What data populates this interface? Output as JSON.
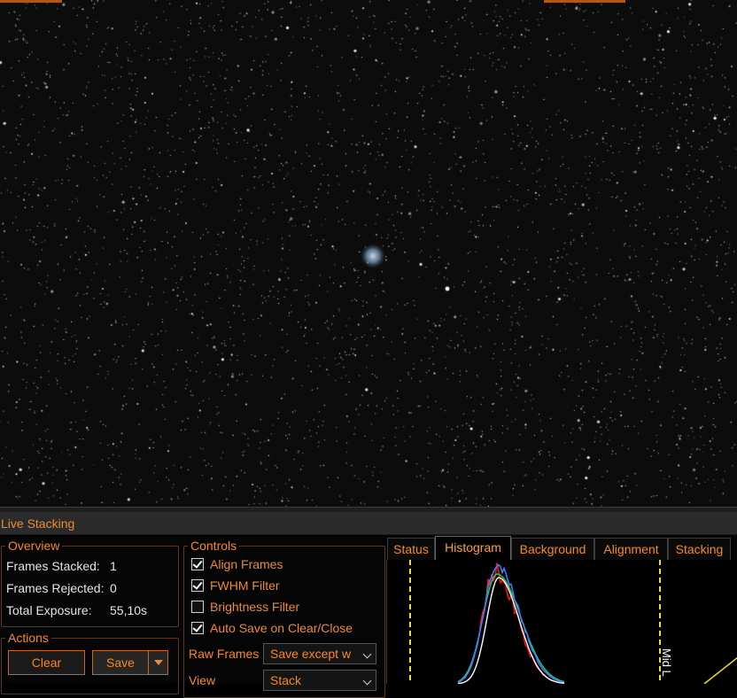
{
  "panel": {
    "title": "Live Stacking"
  },
  "overview": {
    "legend": "Overview",
    "frames_stacked_label": "Frames Stacked:",
    "frames_stacked_value": "1",
    "frames_rejected_label": "Frames Rejected:",
    "frames_rejected_value": "0",
    "total_exposure_label": "Total Exposure:",
    "total_exposure_value": "55,10s"
  },
  "actions": {
    "legend": "Actions",
    "clear_label": "Clear",
    "save_label": "Save"
  },
  "controls": {
    "legend": "Controls",
    "checkboxes": [
      {
        "label": "Align Frames",
        "checked": true
      },
      {
        "label": "FWHM Filter",
        "checked": true
      },
      {
        "label": "Brightness Filter",
        "checked": false
      },
      {
        "label": "Auto Save on Clear/Close",
        "checked": true
      }
    ],
    "raw_frames_label": "Raw Frames",
    "raw_frames_value": "Save except w",
    "view_label": "View",
    "view_value": "Stack"
  },
  "tabs": [
    "Status",
    "Histogram",
    "Background",
    "Alignment",
    "Stacking"
  ],
  "active_tab": "Histogram",
  "histogram": {
    "marker_label": "Mid L"
  },
  "colors": {
    "accent": "#f08a2a",
    "background": "#000000",
    "red": "#ff1010",
    "blue": "#3a7dff",
    "green": "#20d060",
    "marker": "#f0e020"
  }
}
